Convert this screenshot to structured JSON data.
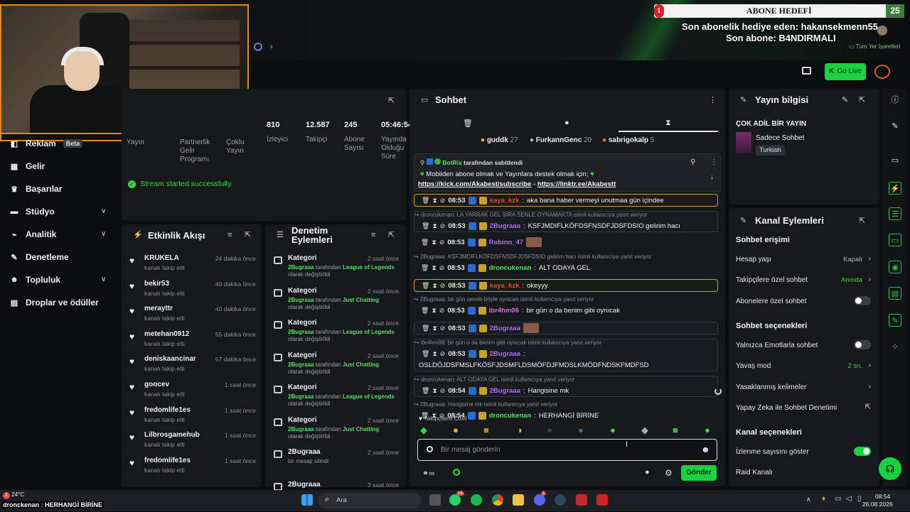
{
  "overlay": {
    "goal_title": "ABONE HEDEFİ",
    "goal_current": "1",
    "goal_target": "25",
    "gift_line": "Son abonelik hediye eden: hakansekmenn55",
    "last_sub": "Son abone: B4NDIRMALI",
    "bookmarks": "Tüm Yer İşaretleri",
    "win_min": "—",
    "win_max": "⧉",
    "win_close": "✕"
  },
  "header": {
    "go_live": "Go Live"
  },
  "nav": {
    "items": [
      {
        "label": "Reklam",
        "badge": "Beta"
      },
      {
        "label": "Gelir"
      },
      {
        "label": "Başarılar"
      },
      {
        "label": "Stüdyo"
      },
      {
        "label": "Analitik"
      },
      {
        "label": "Denetleme"
      },
      {
        "label": "Topluluk"
      },
      {
        "label": "Droplar ve ödüller"
      }
    ]
  },
  "stats": {
    "partial": [
      "Yayın",
      "Partnerlik Gelir Programı",
      "Çoklu Yayın"
    ],
    "items": [
      {
        "value": "810",
        "label": "İzleyici"
      },
      {
        "value": "12.587",
        "label": "Takipçi"
      },
      {
        "value": "245",
        "label": "Abone Sayısı"
      },
      {
        "value": "05:46:54",
        "label": "Yayında Olduğu Süre"
      }
    ],
    "success": "Stream started successfully."
  },
  "activity": {
    "title": "Etkinlik Akışı",
    "items": [
      {
        "name": "KRUKELA",
        "sub": "kanalı takip etti",
        "time": "24 dakika önce"
      },
      {
        "name": "bekir53",
        "sub": "kanalı takip etti",
        "time": "40 dakika önce"
      },
      {
        "name": "merayttr",
        "sub": "kanalı takip etti",
        "time": "40 dakika önce"
      },
      {
        "name": "metehan0912",
        "sub": "kanalı takip etti",
        "time": "55 dakika önce"
      },
      {
        "name": "deniskaancinar",
        "sub": "kanalı takip etti",
        "time": "57 dakika önce"
      },
      {
        "name": "goocev",
        "sub": "kanalı takip etti",
        "time": "1 saat önce"
      },
      {
        "name": "fredomlife1es",
        "sub": "kanalı takip etti",
        "time": "1 saat önce"
      },
      {
        "name": "Lilbrosgamehub",
        "sub": "kanalı takip etti",
        "time": "1 saat önce"
      },
      {
        "name": "fredomlife1es",
        "sub": "kanalı takip etti",
        "time": "1 saat önce"
      }
    ]
  },
  "moderation": {
    "title": "Denetim Eylemleri",
    "items": [
      {
        "name": "Kategori",
        "user": "2Bugraaa",
        "mid": "tarafından",
        "target": "League of Legends",
        "tail": "olarak değiştirildi",
        "time": "2 saat önce"
      },
      {
        "name": "Kategori",
        "user": "2Bugraaa",
        "mid": "tarafından",
        "target": "Just Chatting",
        "tail": "olarak değiştirildi",
        "time": "2 saat önce"
      },
      {
        "name": "Kategori",
        "user": "2Bugraaa",
        "mid": "tarafından",
        "target": "League of Legends",
        "tail": "olarak değiştirildi",
        "time": "2 saat önce"
      },
      {
        "name": "Kategori",
        "user": "2Bugraaa",
        "mid": "tarafından",
        "target": "Just Chatting",
        "tail": "olarak değiştirildi",
        "time": "2 saat önce"
      },
      {
        "name": "Kategori",
        "user": "2Bugraaa",
        "mid": "tarafından",
        "target": "League of Legends",
        "tail": "olarak değiştirildi",
        "time": "2 saat önce"
      },
      {
        "name": "Kategori",
        "user": "2Bugraaa",
        "mid": "tarafından",
        "target": "Just Chatting",
        "tail": "olarak değiştirildi",
        "time": "2 saat önce"
      },
      {
        "name": "2Bugraaa",
        "user": "",
        "mid": "bir mesajı silindi",
        "target": "",
        "tail": "",
        "time": "2 saat önce"
      },
      {
        "name": "2Bugraaa",
        "user": "",
        "mid": "",
        "target": "",
        "tail": "",
        "time": "3 saat önce"
      }
    ]
  },
  "chat": {
    "title": "Sohbet",
    "top_gifters": [
      {
        "name": "guddk",
        "count": "27"
      },
      {
        "name": "FurkannGenc",
        "count": "20"
      },
      {
        "name": "sabrigokalp",
        "count": "5"
      }
    ],
    "pinned_by": "BotRix",
    "pinned_label": "tarafından sabitlendi",
    "pinned_text": "Mobilden abone olmak ve Yayınlara destek olmak için;",
    "pinned_link1": "https://kick.com/Akabest/subscribe",
    "pinned_sep": " - ",
    "pinned_link2": "https://linktr.ee/Akabestt",
    "messages": [
      {
        "reply": "",
        "time": "08:53",
        "user": "kaya_kzk",
        "color": "#e04a3a",
        "text": "aka bana haber vermeyi unutmaa gün içindee",
        "style": "hl"
      },
      {
        "reply": "droncukenan: LA YARRAK GEL SIRA SENLE OYNAMAKTA isimli kullanıcıya yanıt veriyor",
        "time": "08:53",
        "user": "2Bugraaa",
        "color": "#b06bff",
        "text": "KSFJMDIFLKÖFDSFNSDFJDSFDSIO gelirim hacı",
        "style": "bl"
      },
      {
        "reply": "",
        "time": "08:53",
        "user": "Robinn_47",
        "color": "#b06bff",
        "text": "",
        "style": ""
      },
      {
        "reply": "2Bugraaa: KSFJMDIFLKÖFDSFNSDFJDSFDSIO gelirim hacı isimli kullanıcıya yanıt veriyor",
        "time": "08:53",
        "user": "droncukenan",
        "color": "#53e05f",
        "text": "ALT ODAYA GEL",
        "style": ""
      },
      {
        "reply": "",
        "time": "08:53",
        "user": "kaya_kzk",
        "color": "#e04a3a",
        "text": "okeyyy",
        "style": "hl"
      },
      {
        "reply": "2Bugraaa: bir gün sende böyle oynican isimli kullanıcıya yanıt veriyor",
        "time": "08:53",
        "user": "ibr4hm06",
        "color": "#e06ad8",
        "text": "bir gün o da benim gibi oynıcak",
        "style": ""
      },
      {
        "reply": "",
        "time": "08:53",
        "user": "2Bugraaa",
        "color": "#b06bff",
        "text": "",
        "style": "bl"
      },
      {
        "reply": "ibr4hm06: bir gün o da benim gibi oynıcak isimli kullanıcıya yanıt veriyor",
        "time": "08:53",
        "user": "2Bugraaa",
        "color": "#b06bff",
        "text": "OSLDÖJDSFMSLFKÖSFJDSMFLDSMÖFDJFMDSLKMÖDFNDSKFMDFSD",
        "style": "bl"
      },
      {
        "reply": "droncukenan: ALT ODAYA GEL isimli kullanıcıya yanıt veriyor",
        "time": "08:54",
        "user": "2Bugraaa",
        "color": "#b06bff",
        "text": "Hangisine mk",
        "style": "bl"
      },
      {
        "reply": "2Bugraaa: Hangisine mk isimli kullanıcıya yanıt veriyor",
        "time": "08:54",
        "user": "droncukenan",
        "color": "#53e05f",
        "text": "HERHANGİ BİRİNE",
        "style": ""
      }
    ],
    "followers_only": "Takipçilere Özel",
    "input_placeholder": "Bir mesaj gönderin",
    "send_label": "Gönder"
  },
  "stream_info": {
    "title": "Yayın bilgisi",
    "stream_title": "ÇOK ADİL BİR YAYIN",
    "category": "Sadece Sohbet",
    "language": "Turkish"
  },
  "channel_actions": {
    "title": "Kanal Eylemleri",
    "chat_access": "Sohbet erişimi",
    "account_age": "Hesap yaşı",
    "account_age_val": "Kapalı",
    "followers_chat": "Takipçilere özel sohbet",
    "followers_chat_val": "Anında",
    "subs_chat": "Abonelere özel sohbet",
    "chat_options": "Sohbet seçenekleri",
    "emote_only": "Yalnızca Emotlarla sohbet",
    "slow_mode": "Yavaş mod",
    "slow_mode_val": "2 sn.",
    "banned_words": "Yasaklanmış kelimeler",
    "ai_mod": "Yapay Zeka ile Sohbet Denetimi",
    "channel_options": "Kanal seçenekleri",
    "show_viewers": "İzlenme sayısını göster",
    "raid": "Raid Kanalı"
  },
  "taskbar": {
    "weather_temp": "24°C",
    "ticker": "dronckenan : HERHANGİ BİRİNE",
    "search": "Ara",
    "time": "08:54",
    "date": "26.08.2026",
    "badge1": "16",
    "badge2": "1"
  }
}
